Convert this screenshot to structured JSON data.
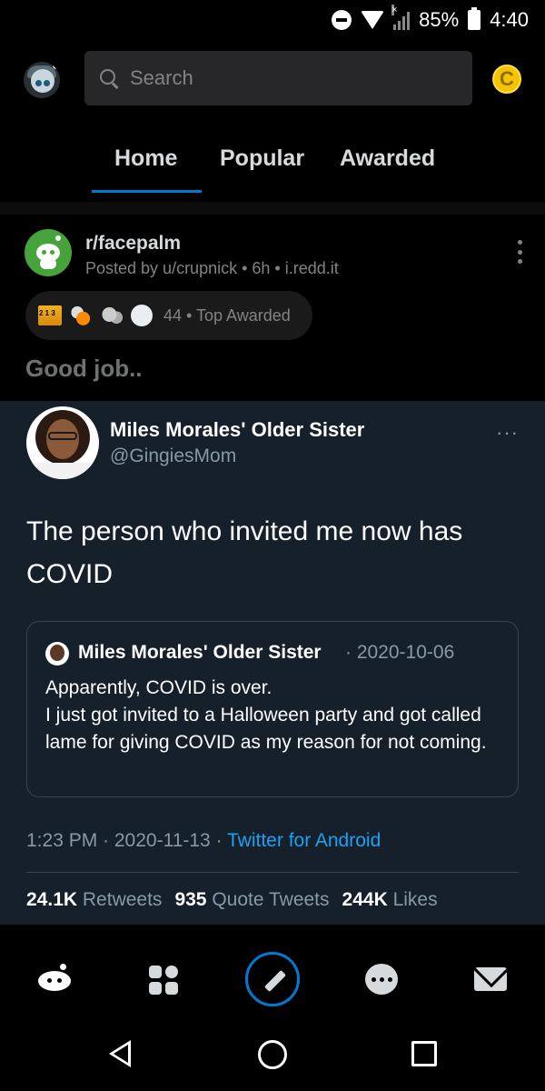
{
  "status_bar": {
    "battery": "85%",
    "time": "4:40"
  },
  "header": {
    "search_placeholder": "Search",
    "coin_label": "C"
  },
  "tabs": [
    {
      "label": "Home",
      "active": true
    },
    {
      "label": "Popular",
      "active": false
    },
    {
      "label": "Awarded",
      "active": false
    }
  ],
  "post": {
    "subreddit": "r/facepalm",
    "meta": "Posted by u/crupnick • 6h • i.redd.it",
    "awards_count": "44",
    "awards_label": "Top Awarded",
    "title": "Good job.."
  },
  "tweet": {
    "name": "Miles Morales' Older Sister",
    "handle": "@GingiesMom",
    "more": "···",
    "text": "The person who invited me now has COVID",
    "quote": {
      "name": "Miles Morales' Older Sister",
      "date": "· 2020-10-06",
      "text_line1": "Apparently, COVID is over.",
      "text_line2": "I just got invited to a Halloween party and got called lame for giving COVID as my reason for not coming."
    },
    "time": "1:23 PM · 2020-11-13 · ",
    "source": "Twitter for Android",
    "stats": {
      "retweets_value": "24.1K",
      "retweets_label": "Retweets",
      "quotes_value": "935",
      "quotes_label": "Quote Tweets",
      "likes_value": "244K",
      "likes_label": "Likes"
    }
  },
  "colors": {
    "accent": "#0079d3",
    "twitter_bg": "#15202b",
    "twitter_link": "#1da1f2",
    "coin": "#f5c400"
  }
}
